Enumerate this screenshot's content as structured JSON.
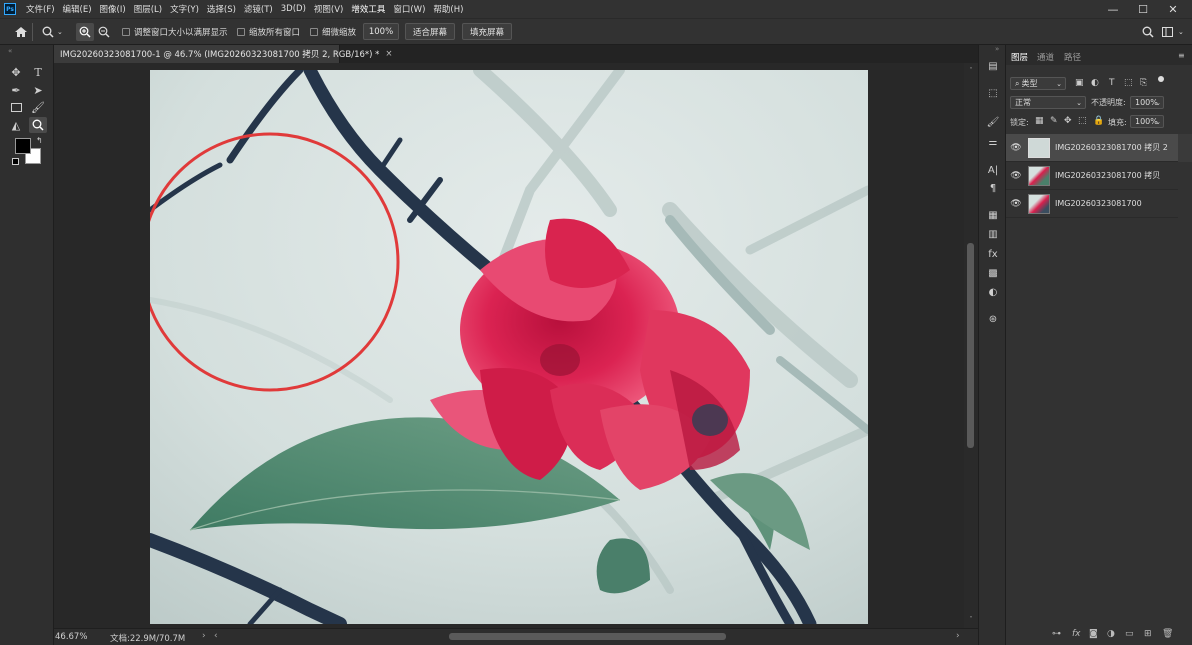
{
  "app": {
    "logo": "Ps"
  },
  "menu": [
    "文件(F)",
    "编辑(E)",
    "图像(I)",
    "图层(L)",
    "文字(Y)",
    "选择(S)",
    "滤镜(T)",
    "3D(D)",
    "视图(V)",
    "增效工具",
    "窗口(W)",
    "帮助(H)"
  ],
  "window_controls": {
    "minimize": "—",
    "restore": "☐",
    "close": "✕"
  },
  "options": {
    "resize_windows": "调整窗口大小以满屏显示",
    "zoom_all": "缩放所有窗口",
    "scrubby_zoom": "细微缩放",
    "zoom_value": "100%",
    "fit_screen": "适合屏幕",
    "fill_screen": "填充屏幕"
  },
  "document": {
    "tab_title": "IMG20260323081700-1 @ 46.7% (IMG20260323081700 拷贝 2, RGB/16*) *",
    "tab_close": "×"
  },
  "status": {
    "zoom": "46.67%",
    "doc_size": "文档:22.9M/70.7M",
    "arrow": "›"
  },
  "layers_panel": {
    "tabs": [
      "图层",
      "通道",
      "路径"
    ],
    "filter_kind": "类型",
    "blend_mode": "正常",
    "opacity_label": "不透明度:",
    "opacity_value": "100%",
    "lock_label": "锁定:",
    "fill_label": "填充:",
    "fill_value": "100%",
    "layers": [
      {
        "name": "IMG20260323081700 拷贝 2",
        "selected": true
      },
      {
        "name": "IMG20260323081700 拷贝",
        "selected": false
      },
      {
        "name": "IMG20260323081700",
        "selected": false
      }
    ],
    "footer_icons": [
      "link-icon",
      "fx-icon",
      "mask-icon",
      "adjustment-icon",
      "group-icon",
      "new-layer-icon",
      "trash-icon"
    ]
  },
  "colors": {
    "accent_red": "#e03a3a",
    "petal": "#d8204d",
    "photo_bg": "#d6e1df"
  }
}
